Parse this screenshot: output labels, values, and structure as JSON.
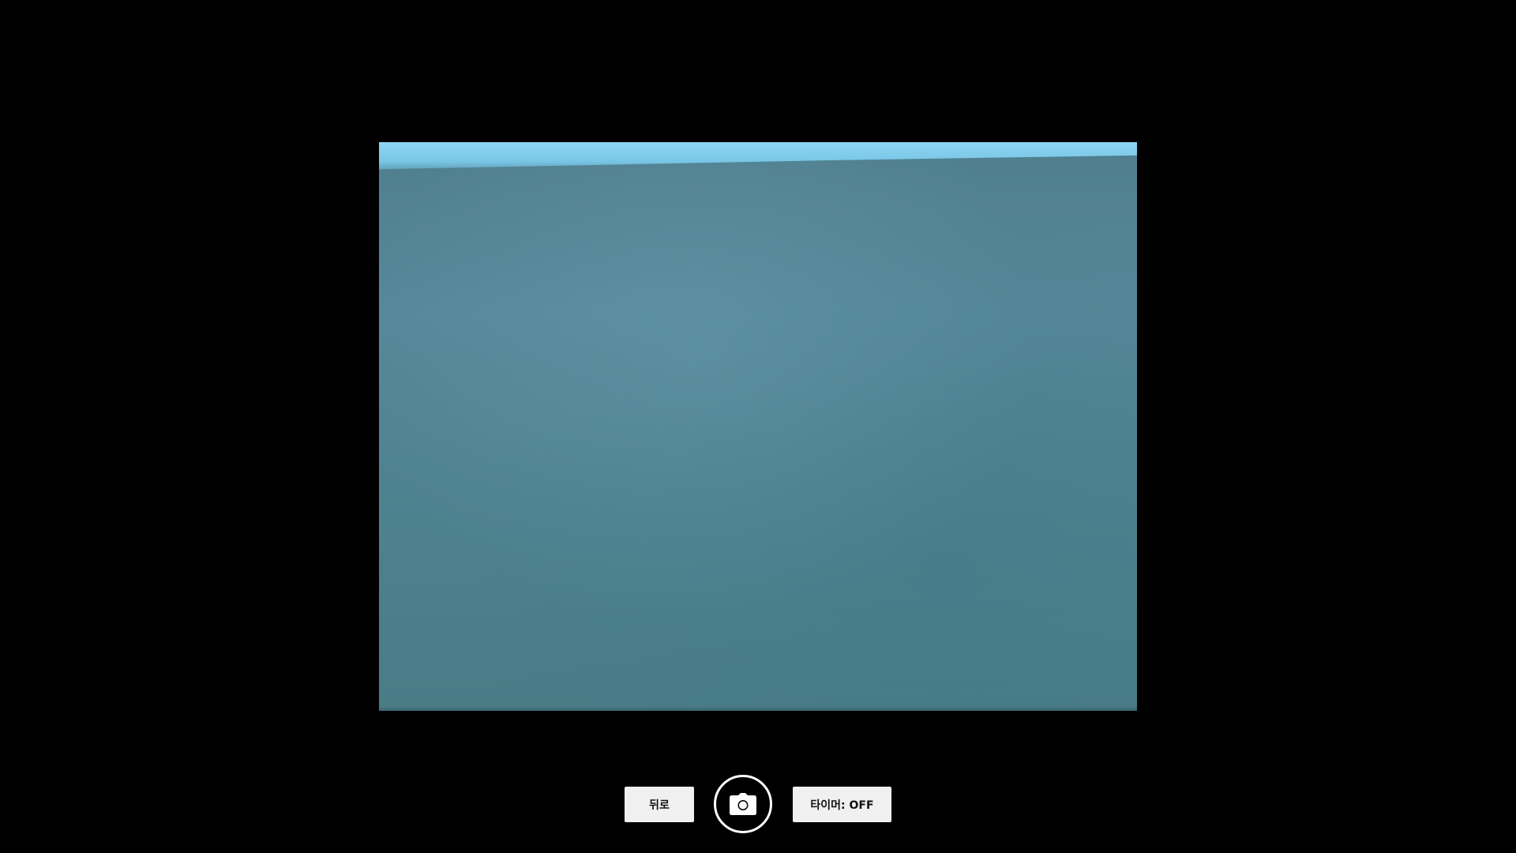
{
  "camera": {
    "preview": "live-camera-feed"
  },
  "controls": {
    "back_label": "뒤로",
    "shutter_icon": "camera-icon",
    "timer_label": "타이머: OFF"
  },
  "colors": {
    "background": "#000000",
    "button_bg": "#f0f0f0",
    "button_text": "#111111",
    "shutter_ring": "#ffffff"
  }
}
